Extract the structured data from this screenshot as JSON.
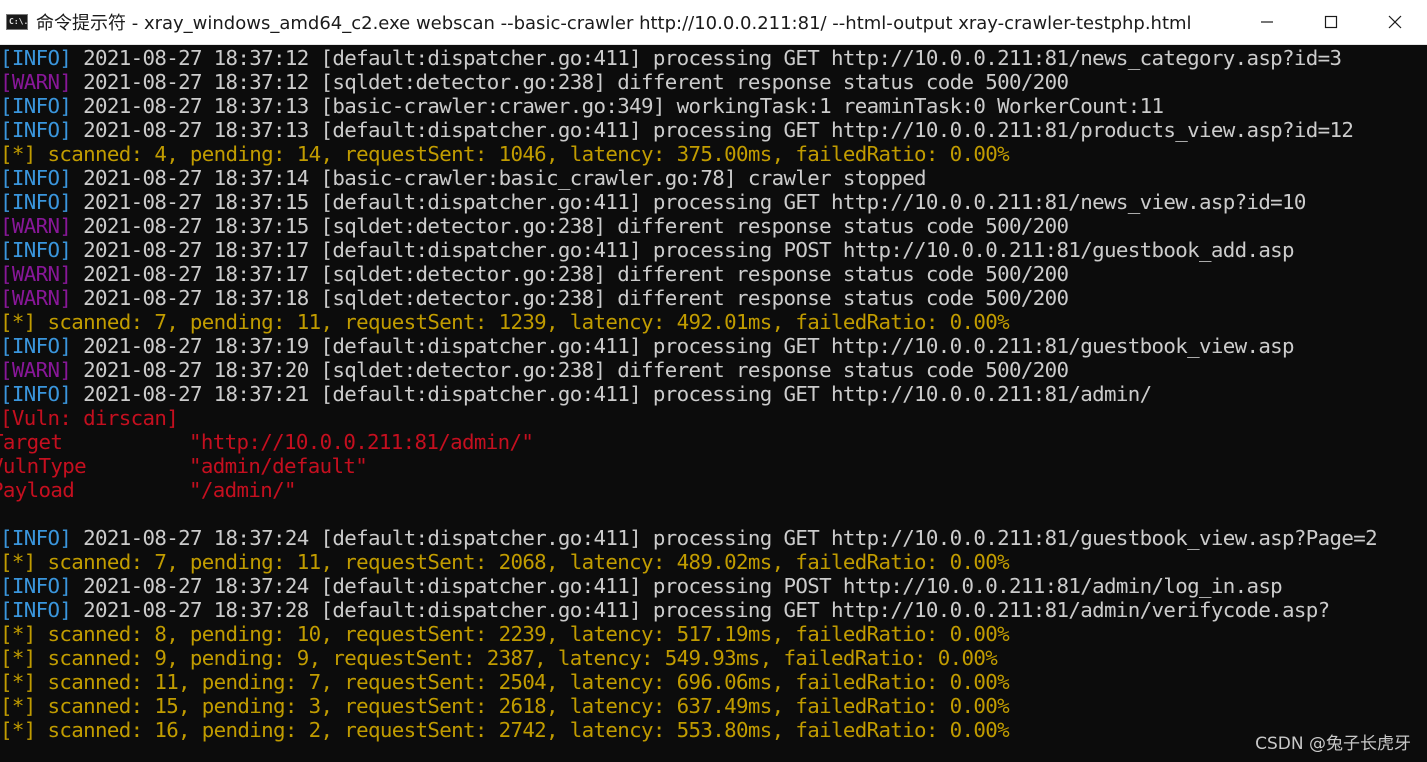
{
  "window": {
    "title": "命令提示符 - xray_windows_amd64_c2.exe  webscan --basic-crawler http://10.0.0.211:81/ --html-output xray-crawler-testphp.html",
    "icon_text": "C:\\."
  },
  "colors": {
    "info_tag": "#3a96dd",
    "warn_tag": "#881798",
    "log_text": "#cccccc",
    "progress": "#c19c00",
    "vuln": "#c50f1f",
    "background": "#0c0c0c"
  },
  "log_group_1": [
    {
      "tag": "[INFO]",
      "msg": " 2021-08-27 18:37:12 [default:dispatcher.go:411] processing GET http://10.0.0.211:81/news_category.asp?id=3"
    },
    {
      "tag": "[WARN]",
      "msg": " 2021-08-27 18:37:12 [sqldet:detector.go:238] different response status code 500/200"
    },
    {
      "tag": "[INFO]",
      "msg": " 2021-08-27 18:37:13 [basic-crawler:crawer.go:349] workingTask:1 reaminTask:0 WorkerCount:11"
    },
    {
      "tag": "[INFO]",
      "msg": " 2021-08-27 18:37:13 [default:dispatcher.go:411] processing GET http://10.0.0.211:81/products_view.asp?id=12"
    }
  ],
  "progress_1": "[*] scanned: 4, pending: 14, requestSent: 1046, latency: 375.00ms, failedRatio: 0.00%",
  "log_group_2": [
    {
      "tag": "[INFO]",
      "msg": " 2021-08-27 18:37:14 [basic-crawler:basic_crawler.go:78] crawler stopped"
    },
    {
      "tag": "[INFO]",
      "msg": " 2021-08-27 18:37:15 [default:dispatcher.go:411] processing GET http://10.0.0.211:81/news_view.asp?id=10"
    },
    {
      "tag": "[WARN]",
      "msg": " 2021-08-27 18:37:15 [sqldet:detector.go:238] different response status code 500/200"
    },
    {
      "tag": "[INFO]",
      "msg": " 2021-08-27 18:37:17 [default:dispatcher.go:411] processing POST http://10.0.0.211:81/guestbook_add.asp"
    },
    {
      "tag": "[WARN]",
      "msg": " 2021-08-27 18:37:17 [sqldet:detector.go:238] different response status code 500/200"
    },
    {
      "tag": "[WARN]",
      "msg": " 2021-08-27 18:37:18 [sqldet:detector.go:238] different response status code 500/200"
    }
  ],
  "progress_2": "[*] scanned: 7, pending: 11, requestSent: 1239, latency: 492.01ms, failedRatio: 0.00%",
  "log_group_3": [
    {
      "tag": "[INFO]",
      "msg": " 2021-08-27 18:37:19 [default:dispatcher.go:411] processing GET http://10.0.0.211:81/guestbook_view.asp"
    },
    {
      "tag": "[WARN]",
      "msg": " 2021-08-27 18:37:20 [sqldet:detector.go:238] different response status code 500/200"
    },
    {
      "tag": "[INFO]",
      "msg": " 2021-08-27 18:37:21 [default:dispatcher.go:411] processing GET http://10.0.0.211:81/admin/"
    }
  ],
  "vuln": {
    "header": "[Vuln: dirscan]",
    "rows": [
      {
        "label": "Target",
        "value": "\"http://10.0.0.211:81/admin/\""
      },
      {
        "label": "VulnType",
        "value": "\"admin/default\""
      },
      {
        "label": "Payload",
        "value": "\"/admin/\""
      }
    ]
  },
  "log_group_4": [
    {
      "tag": "[INFO]",
      "msg": " 2021-08-27 18:37:24 [default:dispatcher.go:411] processing GET http://10.0.0.211:81/guestbook_view.asp?Page=2"
    }
  ],
  "progress_3": "[*] scanned: 7, pending: 11, requestSent: 2068, latency: 489.02ms, failedRatio: 0.00%",
  "log_group_5": [
    {
      "tag": "[INFO]",
      "msg": " 2021-08-27 18:37:24 [default:dispatcher.go:411] processing POST http://10.0.0.211:81/admin/log_in.asp"
    },
    {
      "tag": "[INFO]",
      "msg": " 2021-08-27 18:37:28 [default:dispatcher.go:411] processing GET http://10.0.0.211:81/admin/verifycode.asp?"
    }
  ],
  "progress_final": [
    "[*] scanned: 8, pending: 10, requestSent: 2239, latency: 517.19ms, failedRatio: 0.00%",
    "[*] scanned: 9, pending: 9, requestSent: 2387, latency: 549.93ms, failedRatio: 0.00%",
    "[*] scanned: 11, pending: 7, requestSent: 2504, latency: 696.06ms, failedRatio: 0.00%",
    "[*] scanned: 15, pending: 3, requestSent: 2618, latency: 637.49ms, failedRatio: 0.00%",
    "[*] scanned: 16, pending: 2, requestSent: 2742, latency: 553.80ms, failedRatio: 0.00%"
  ],
  "watermark": "CSDN @兔子长虎牙"
}
